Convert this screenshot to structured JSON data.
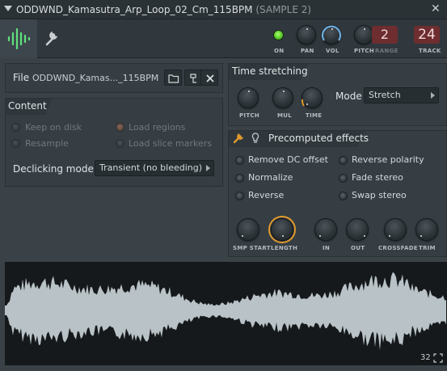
{
  "window": {
    "title": "ODDWND_Kamasutra_Arp_Loop_02_Cm_115BPM",
    "title_suffix": "(SAMPLE 2)",
    "close_glyph": "✕"
  },
  "toolbar": {
    "on_label": "ON",
    "pan_label": "PAN",
    "vol_label": "VOL",
    "pitch_label": "PITCH",
    "range_label": "RANGE",
    "range_value": "2",
    "track_label": "TRACK",
    "track_value": "24",
    "tabs": [
      {
        "name": "waveform-icon",
        "active": true
      },
      {
        "name": "wrench-icon",
        "active": false
      }
    ]
  },
  "file": {
    "label": "File",
    "name": "ODDWND_Kamas..._115BPM.wav"
  },
  "content": {
    "title": "Content",
    "keep_on_disk": "Keep on disk",
    "resample": "Resample",
    "load_regions": "Load regions",
    "load_slice_markers": "Load slice markers",
    "declicking_label": "Declicking mode",
    "declicking_value": "Transient (no bleeding)"
  },
  "time_stretching": {
    "title": "Time stretching",
    "knobs": [
      "PITCH",
      "MUL",
      "TIME"
    ],
    "mode_label": "Mode",
    "mode_value": "Stretch"
  },
  "precomputed": {
    "title": "Precomputed effects",
    "options": [
      "Remove DC offset",
      "Normalize",
      "Reverse",
      "Reverse polarity",
      "Fade stereo",
      "Swap stereo"
    ],
    "knobs": [
      "SMP START",
      "LENGTH",
      "IN",
      "OUT",
      "CROSSFADE",
      "TRIM"
    ]
  },
  "waveform": {
    "zoom_value": "32"
  },
  "colors": {
    "accent_orange": "#e09a2c",
    "vol_blue": "#6fb6e8",
    "led_green": "#58c82c",
    "digit_bg": "#6e2d2f",
    "wave_fill": "#b9c2c6"
  }
}
